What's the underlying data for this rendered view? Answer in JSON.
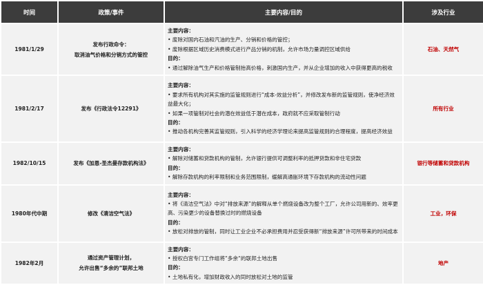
{
  "headers": [
    "时间",
    "政策/事件",
    "主要内容/目的",
    "涉及行业"
  ],
  "labels": {
    "content": "主要内容：",
    "purpose": "目的："
  },
  "rows": [
    {
      "time": "1981/1/29",
      "policy": [
        "发布行政命令：",
        "取消油气价格和分销方式的管控"
      ],
      "content": [
        "• 废除对国内石油和汽油的生产、分销和价格的管控；",
        "• 废除根据区域历史消费模式进行产品分销的机制，允许市场力量调控区域供给"
      ],
      "purpose": [
        "• 通过解除油气生产和价格管制抬高价格，刺激国内生产，并从企业增加的收入中获得更高的税收"
      ],
      "industry": "石油、天然气"
    },
    {
      "time": "1981/2/17",
      "policy": [
        "发布《行政法令12291》"
      ],
      "content": [
        "• 要求所有机构对其实施的监管规则进行“成本-效益分析”，并修改发布新的监管规则，使净经济效益最大化；",
        "• 如果一项管制对社会的潜在效益低于潜在成本，政府就不应采取管制行动"
      ],
      "purpose": [
        "• 推动各机构完善其监管规则，引入科学的经济学理论来提高监管规则的合理程度，提高经济效益"
      ],
      "industry": "所有行业"
    },
    {
      "time": "1982/10/15",
      "policy": [
        "发布《加恩-圣杰曼存款机构法》"
      ],
      "content": [
        "• 解除对储蓄和贷款机构的管制，允许银行提供可调整利率的抵押贷款和非住宅贷款"
      ],
      "purpose": [
        "• 解除存款机构的利率限制和业务范围限制，缓解高通胀环境下存款机构的流动性问题"
      ],
      "industry": "银行等储蓄和贷款机构"
    },
    {
      "time": "1980年代中期",
      "policy": [
        "修改《清洁空气法》"
      ],
      "content": [
        "• 将《清洁空气法》中对“排放来源”的解释从单个燃烧设备改为整个工厂，允许公司用新的、效率更高、污染更少的设备替换过时的燃烧设备"
      ],
      "purpose": [
        "• 放松对排放的管制，同时让工业企业不必承担费用并忍受获得新“排放来源”许可所带来的时间成本"
      ],
      "industry": "工业，环保"
    },
    {
      "time": "1982年2月",
      "policy": [
        "通过资产管理计划，",
        "允许出售“多余的”联邦土地"
      ],
      "content": [
        "• 授权白宫专门工作组将“多余“的联邦土地出售"
      ],
      "purpose": [
        "• 土地私有化，增加财政收入的同时放松对土地的监管"
      ],
      "industry": "地产"
    }
  ]
}
